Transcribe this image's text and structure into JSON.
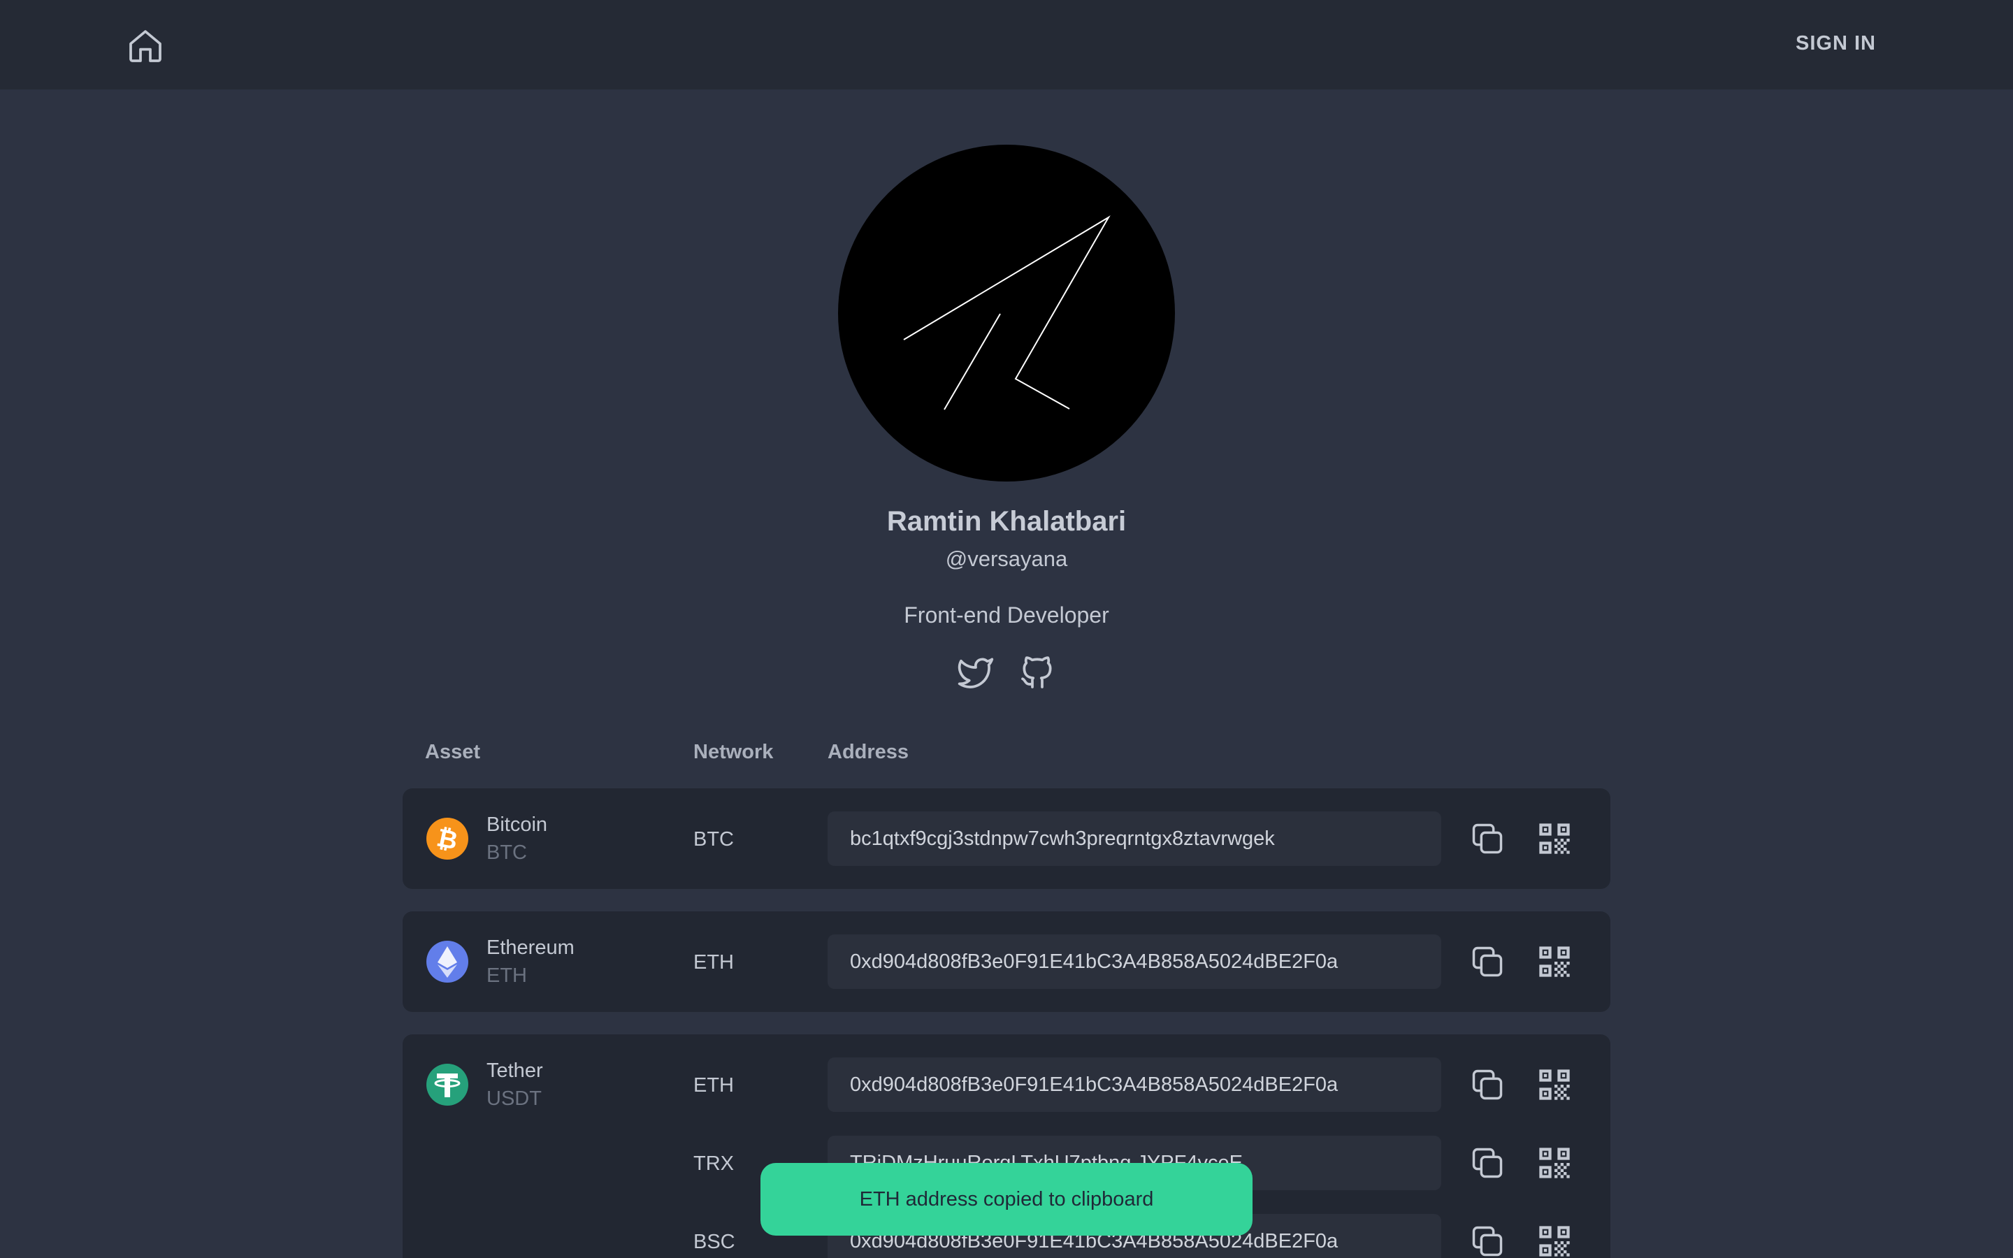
{
  "header": {
    "sign_in": "SIGN IN"
  },
  "profile": {
    "name": "Ramtin Khalatbari",
    "handle": "@versayana",
    "bio": "Front-end Developer"
  },
  "table": {
    "headers": {
      "asset": "Asset",
      "network": "Network",
      "address": "Address"
    },
    "rows": [
      {
        "name": "Bitcoin",
        "symbol": "BTC",
        "network": "BTC",
        "address": "bc1qtxf9cgj3stdnpw7cwh3preqrntgx8ztavrwgek"
      },
      {
        "name": "Ethereum",
        "symbol": "ETH",
        "network": "ETH",
        "address": "0xd904d808fB3e0F91E41bC3A4B858A5024dBE2F0a"
      },
      {
        "name": "Tether",
        "symbol": "USDT",
        "networks": [
          {
            "network": "ETH",
            "address": "0xd904d808fB3e0F91E41bC3A4B858A5024dBE2F0a"
          },
          {
            "network": "TRX",
            "address": "TRiDMzHruuRorgLTxhU7ptbng JYPF4vceE"
          },
          {
            "network": "BSC",
            "address": "0xd904d808fB3e0F91E41bC3A4B858A5024dBE2F0a"
          }
        ]
      }
    ]
  },
  "toast": {
    "message": "ETH address copied to clipboard"
  },
  "colors": {
    "background": "#2d3342",
    "topbar": "#252a35",
    "card": "#222732",
    "toast": "#34d399",
    "bitcoin": "#f7931a",
    "ethereum": "#627eea",
    "tether": "#26a17b"
  },
  "icons": [
    "home-icon",
    "twitter-icon",
    "github-icon",
    "copy-icon",
    "qr-code-icon",
    "bitcoin-icon",
    "ethereum-icon",
    "tether-icon"
  ]
}
